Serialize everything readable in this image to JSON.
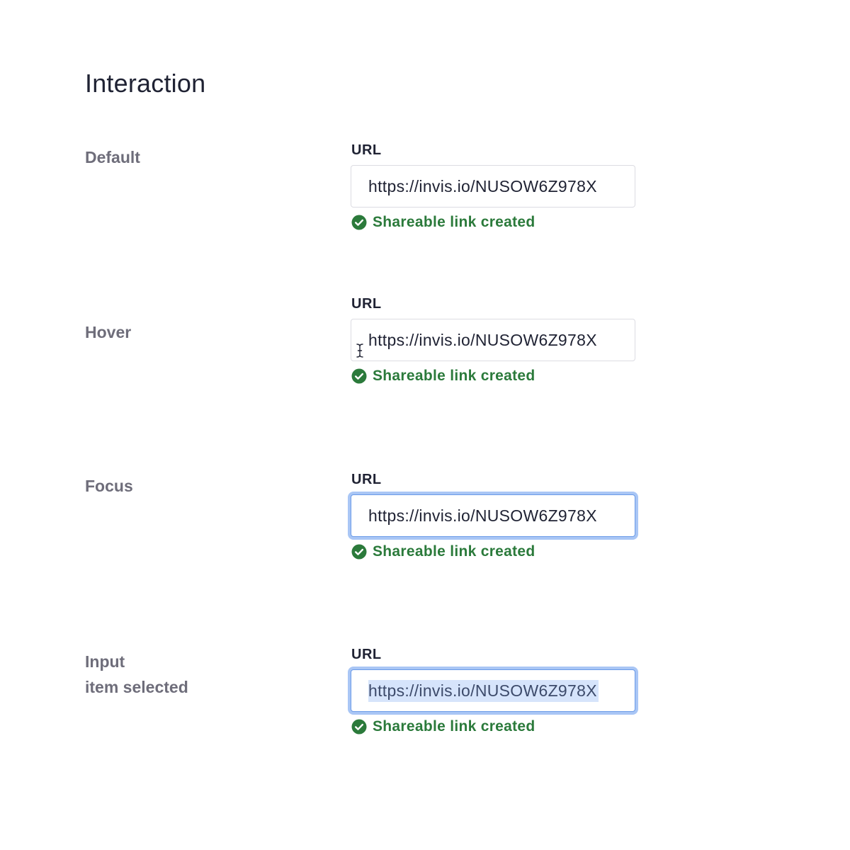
{
  "page": {
    "title": "Interaction"
  },
  "colors": {
    "success": "#2b7a3b",
    "focus_ring": "#a9c6f5",
    "focus_border": "#6a9be8",
    "selection": "#d6e4fb",
    "label_muted": "#6e6d7a",
    "text_primary": "#1f2233"
  },
  "states": [
    {
      "label": "Default",
      "field_label": "URL",
      "value": "https://invis.io/NUSOW6Z978X",
      "helper": "Shareable link created",
      "helper_icon": "check-circle-icon"
    },
    {
      "label": "Hover",
      "field_label": "URL",
      "value": "https://invis.io/NUSOW6Z978X",
      "helper": "Shareable link created",
      "helper_icon": "check-circle-icon",
      "cursor_icon": "text-cursor-icon"
    },
    {
      "label": "Focus",
      "field_label": "URL",
      "value": "https://invis.io/NUSOW6Z978X",
      "helper": "Shareable link created",
      "helper_icon": "check-circle-icon"
    },
    {
      "label": "Input\nitem selected",
      "field_label": "URL",
      "value": "https://invis.io/NUSOW6Z978X",
      "helper": "Shareable link created",
      "helper_icon": "check-circle-icon"
    }
  ]
}
